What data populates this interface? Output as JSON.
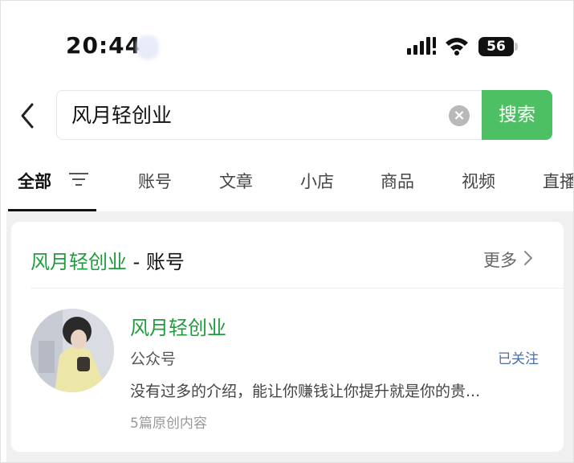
{
  "status_bar": {
    "time": "20:44",
    "battery": "56"
  },
  "search": {
    "query": "风月轻创业",
    "button_label": "搜索"
  },
  "tabs": [
    {
      "label": "全部",
      "active": true
    },
    {
      "label": "账号"
    },
    {
      "label": "文章"
    },
    {
      "label": "小店"
    },
    {
      "label": "商品"
    },
    {
      "label": "视频"
    },
    {
      "label": "直播"
    }
  ],
  "section": {
    "highlight": "风月轻创业",
    "suffix": " - 账号",
    "more_label": "更多"
  },
  "account": {
    "name": "风月轻创业",
    "type": "公众号",
    "follow_status": "已关注",
    "description": "没有过多的介绍，能让你赚钱让你提升就是你的贵...",
    "article_count": "5篇原创内容"
  },
  "colors": {
    "accent_green": "#4cc063",
    "highlight_green": "#1f9d3d",
    "follow_blue": "#4a6ea8"
  }
}
